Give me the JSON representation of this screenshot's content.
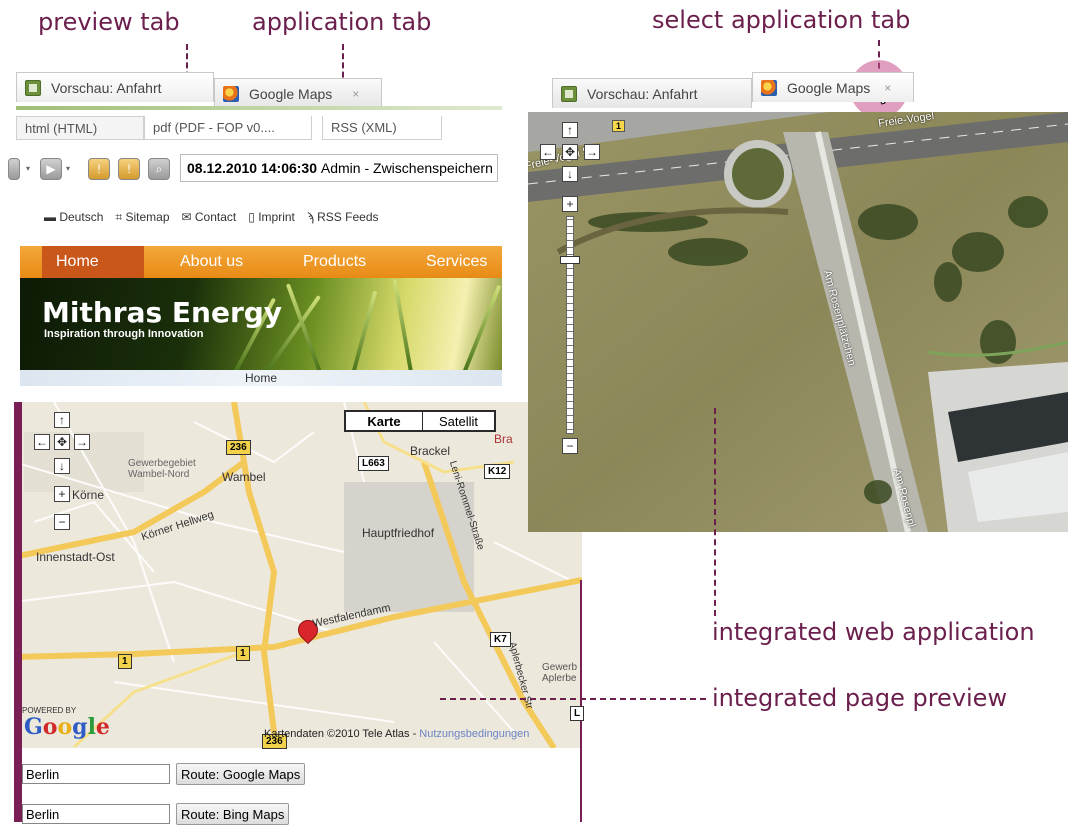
{
  "annotations": {
    "preview_tab": "preview tab",
    "application_tab": "application tab",
    "select_application_tab": "select application tab",
    "integrated_web_application": "integrated web application",
    "integrated_page_preview": "integrated page preview"
  },
  "preview_window": {
    "tabs": [
      {
        "label": "Vorschau: Anfahrt"
      },
      {
        "label": "Google Maps",
        "close": "×"
      }
    ],
    "format_tabs": [
      "html (HTML)",
      "pdf (PDF - FOP v0....",
      "RSS (XML)"
    ],
    "toolbar_status": {
      "datetime": "08.12.2010 14:06:30",
      "text": "Admin - Zwischenspeichern"
    },
    "site_nav": [
      "Deutsch",
      "Sitemap",
      "Contact",
      "Imprint",
      "RSS Feeds"
    ],
    "menu": [
      "Home",
      "About us",
      "Products",
      "Services"
    ],
    "banner": {
      "title": "Mithras Energy",
      "tagline": "Inspiration through Innovation"
    },
    "breadcrumb": "Home"
  },
  "preview_map": {
    "type_buttons": [
      "Karte",
      "Satellit"
    ],
    "places": [
      "Brackel",
      "Gewerbegebiet Wambel-Nord",
      "Wambel",
      "Körne",
      "Körner Hellweg",
      "Innenstadt-Ost",
      "Hauptfriedhof",
      "Westfalendamm",
      "Leni-Rommel-Straße",
      "Aplerbecker Str",
      "Gewerb Aplerbe",
      "Bra"
    ],
    "route_shields": [
      "236",
      "L663",
      "K12",
      "1",
      "1",
      "K7",
      "236",
      "L"
    ],
    "powered_by": "POWERED BY",
    "logo": "Google",
    "copyright": "Kartendaten ©2010 Tele Atlas - ",
    "terms_link": "Nutzungsbedingungen",
    "routes": [
      {
        "field": "Berlin",
        "button": "Route: Google Maps"
      },
      {
        "field": "Berlin",
        "button": "Route: Bing Maps"
      }
    ]
  },
  "app_window": {
    "tabs": [
      {
        "label": "Vorschau: Anfahrt"
      },
      {
        "label": "Google Maps",
        "close": "×"
      }
    ],
    "street_labels": [
      "Freie-Vogel",
      "Am Rosenplätzchen",
      "Am Rosenpl",
      "Freie-Vogel Str",
      "1"
    ]
  },
  "colors": {
    "annotation": "#6b1f4c",
    "menu": "#ee9422",
    "menu_active": "#c9571a",
    "preview_frame": "#7a1e56"
  }
}
